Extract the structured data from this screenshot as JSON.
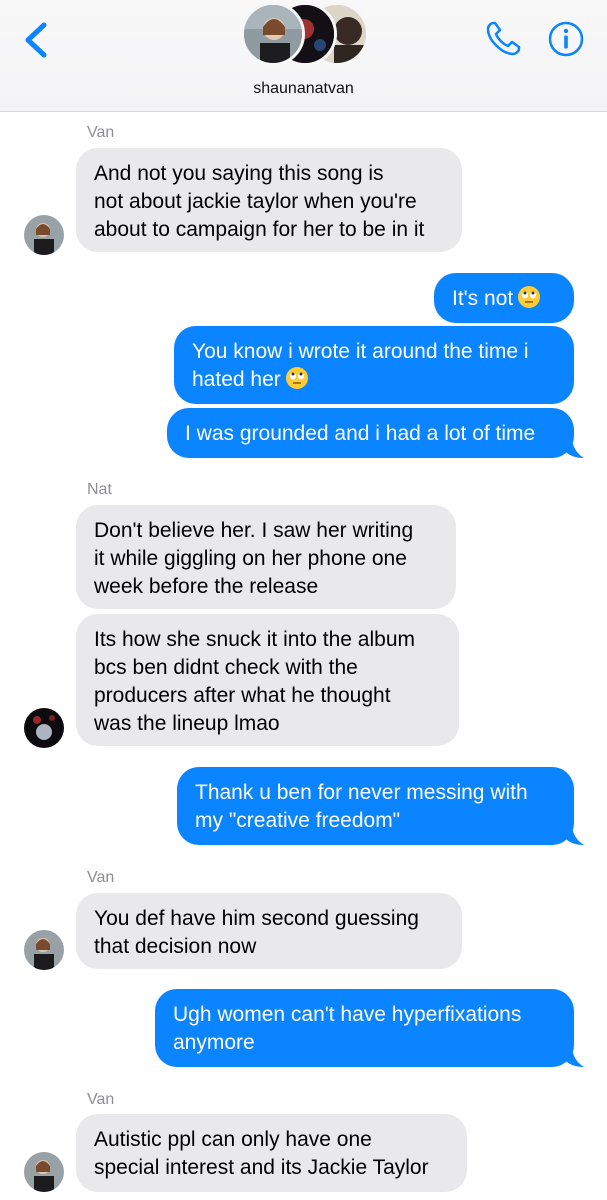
{
  "header": {
    "group_name": "shaunanatvan",
    "back_icon": "chevron-left-icon",
    "call_icon": "phone-icon",
    "info_icon": "info-icon",
    "accent_color": "#0a84ff"
  },
  "messages": [
    {
      "sender": "Van",
      "direction": "in",
      "lines": [
        "And not you saying this song is",
        "not about jackie taylor when you're",
        "about to campaign for her to be in it"
      ]
    },
    {
      "direction": "out",
      "lines": [
        "It's not"
      ],
      "emoji": "eye-roll-emoji"
    },
    {
      "direction": "out",
      "lines": [
        "You know i wrote it around the time i",
        "hated her"
      ],
      "emoji": "eye-roll-emoji"
    },
    {
      "direction": "out",
      "lines": [
        "I was grounded and i had a lot of time"
      ]
    },
    {
      "sender": "Nat",
      "direction": "in",
      "lines": [
        "Don't believe her. I saw her writing",
        "it while giggling on her phone one",
        "week before the release"
      ]
    },
    {
      "direction": "in",
      "lines": [
        "Its how she snuck it into the album",
        "bcs ben didnt check with the",
        "producers after what he thought",
        "was the lineup lmao"
      ]
    },
    {
      "direction": "out",
      "lines": [
        "Thank u ben for never messing with",
        "my \"creative freedom\""
      ]
    },
    {
      "sender": "Van",
      "direction": "in",
      "lines": [
        "You def have him second guessing",
        "that decision now"
      ]
    },
    {
      "direction": "out",
      "lines": [
        "Ugh women can't have hyperfixations",
        "anymore"
      ]
    },
    {
      "sender": "Van",
      "direction": "in",
      "lines": [
        "Autistic ppl can only have one",
        "special interest and its Jackie Taylor"
      ]
    }
  ]
}
